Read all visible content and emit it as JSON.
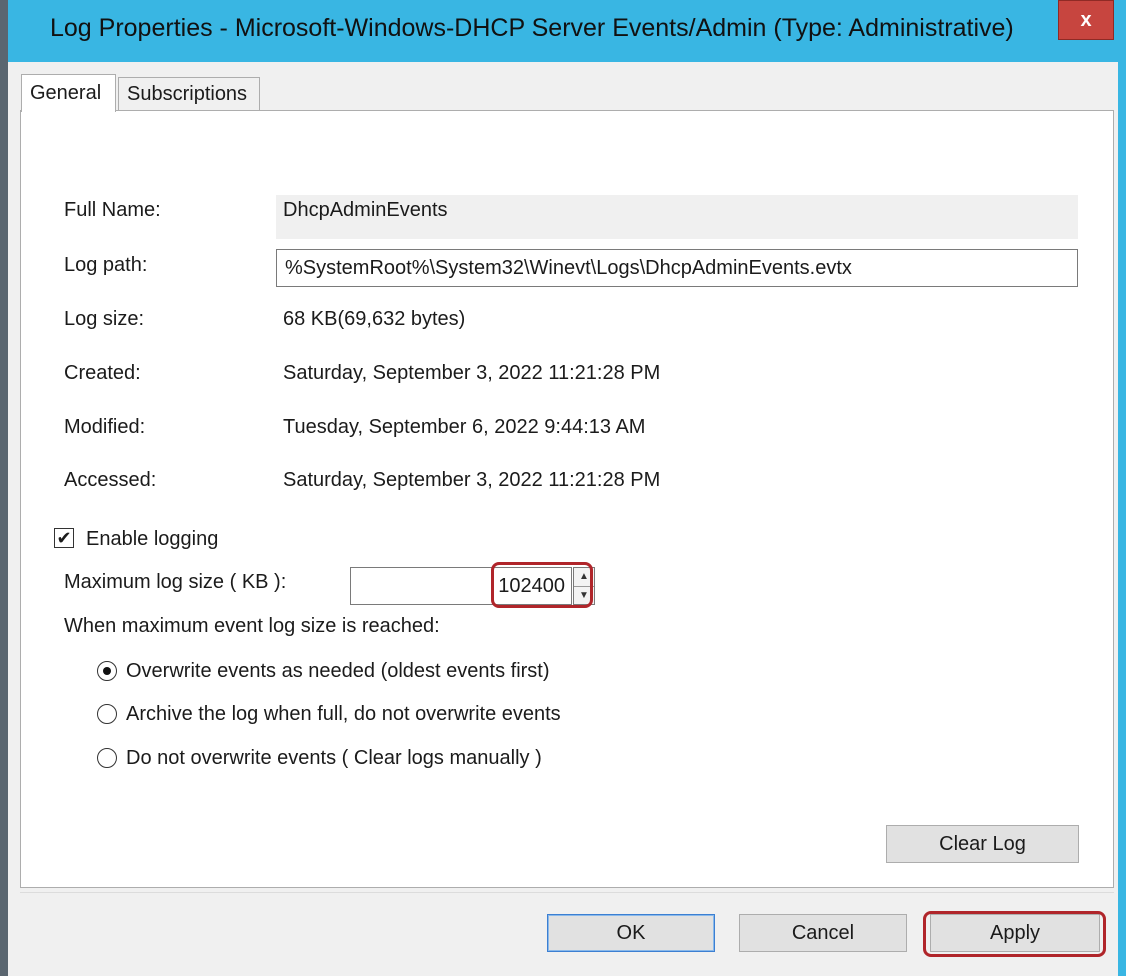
{
  "window": {
    "title": "Log Properties - Microsoft-Windows-DHCP Server Events/Admin (Type: Administrative)",
    "close_label": "x"
  },
  "tabs": [
    {
      "label": "General",
      "active": true
    },
    {
      "label": "Subscriptions",
      "active": false
    }
  ],
  "fields": {
    "full_name": {
      "label": "Full Name:",
      "value": "DhcpAdminEvents"
    },
    "log_path": {
      "label": "Log path:",
      "value": "%SystemRoot%\\System32\\Winevt\\Logs\\DhcpAdminEvents.evtx"
    },
    "log_size": {
      "label": "Log size:",
      "value": "68 KB(69,632 bytes)"
    },
    "created": {
      "label": "Created:",
      "value": "Saturday, September 3, 2022 11:21:28 PM"
    },
    "modified": {
      "label": "Modified:",
      "value": "Tuesday, September 6, 2022 9:44:13 AM"
    },
    "accessed": {
      "label": "Accessed:",
      "value": "Saturday, September 3, 2022 11:21:28 PM"
    }
  },
  "logging": {
    "enable_label": "Enable logging",
    "enabled": true,
    "max_size_label": "Maximum log size ( KB ):",
    "max_size_value": "102400",
    "when_reached_label": "When maximum event log size is reached:",
    "options": [
      {
        "label": "Overwrite events as needed (oldest events first)",
        "checked": true
      },
      {
        "label": "Archive the log when full, do not overwrite events",
        "checked": false
      },
      {
        "label": "Do not overwrite events ( Clear logs manually )",
        "checked": false
      }
    ]
  },
  "buttons": {
    "clear_log": "Clear Log",
    "ok": "OK",
    "cancel": "Cancel",
    "apply": "Apply"
  },
  "colors": {
    "titlebar": "#39b6e3",
    "close": "#c7453f",
    "highlight": "#b0252a"
  }
}
